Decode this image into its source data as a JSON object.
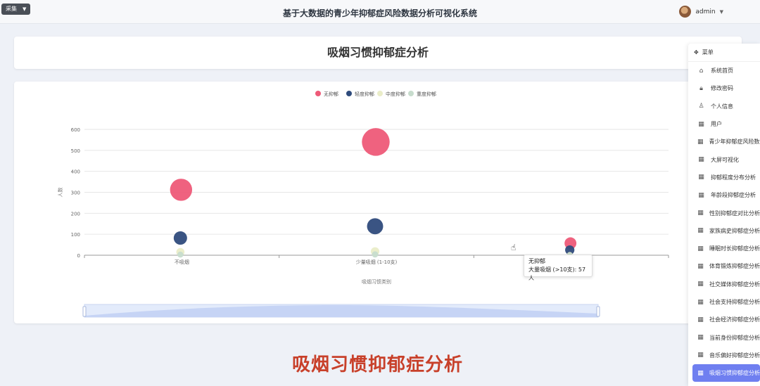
{
  "topbar": {
    "collect_label": "采集",
    "app_title": "基于大数据的青少年抑郁症风险数据分析可视化系统",
    "username": "admin"
  },
  "page": {
    "card_title": "吸烟习惯抑郁症分析",
    "big_title": "吸烟习惯抑郁症分析"
  },
  "tooltip": {
    "series": "无抑郁",
    "detail": "大量吸烟 (>10支): 57人"
  },
  "menu": {
    "header": "菜单",
    "items": [
      {
        "label": "系统首页",
        "icon": "home-icon"
      },
      {
        "label": "修改密码",
        "icon": "lock-icon"
      },
      {
        "label": "个人信息",
        "icon": "user-icon"
      },
      {
        "label": "用户",
        "icon": "grid-icon"
      },
      {
        "label": "青少年抑郁症风险数据",
        "icon": "grid-icon"
      },
      {
        "label": "大屏可视化",
        "icon": "grid-icon"
      },
      {
        "label": "抑郁程度分布分析",
        "icon": "grid-icon"
      },
      {
        "label": "年龄段抑郁症分析",
        "icon": "grid-icon"
      },
      {
        "label": "性别抑郁症对比分析",
        "icon": "grid-icon"
      },
      {
        "label": "家族病史抑郁症分析",
        "icon": "grid-icon"
      },
      {
        "label": "睡眠时长抑郁症分析",
        "icon": "grid-icon"
      },
      {
        "label": "体育锻炼抑郁症分析",
        "icon": "grid-icon"
      },
      {
        "label": "社交媒体抑郁症分析",
        "icon": "grid-icon"
      },
      {
        "label": "社会支持抑郁症分析",
        "icon": "grid-icon"
      },
      {
        "label": "社会经济抑郁症分析",
        "icon": "grid-icon"
      },
      {
        "label": "当前身份抑郁症分析",
        "icon": "grid-icon"
      },
      {
        "label": "音乐偏好抑郁症分析",
        "icon": "grid-icon"
      },
      {
        "label": "吸烟习惯抑郁症分析",
        "icon": "grid-icon",
        "active": true
      }
    ]
  },
  "chart_data": {
    "type": "scatter",
    "xlabel": "吸烟习惯类别",
    "ylabel": "人数",
    "categories": [
      "不吸烟",
      "少量吸烟 (1-10支)",
      "大量吸烟 (>10支)"
    ],
    "ylim": [
      0,
      600
    ],
    "yticks": [
      0,
      100,
      200,
      300,
      400,
      500,
      600
    ],
    "legend_position": "top-center",
    "grid": true,
    "series": [
      {
        "name": "无抑郁",
        "color": "#ee5a78",
        "values": [
          312,
          540,
          57
        ]
      },
      {
        "name": "轻度抑郁",
        "color": "#2f4b7c",
        "values": [
          82,
          138,
          25
        ]
      },
      {
        "name": "中度抑郁",
        "color": "#eaedc8",
        "values": [
          15,
          18,
          2
        ]
      },
      {
        "name": "重度抑郁",
        "color": "#c7dccd",
        "values": [
          3,
          4,
          1
        ]
      }
    ]
  }
}
